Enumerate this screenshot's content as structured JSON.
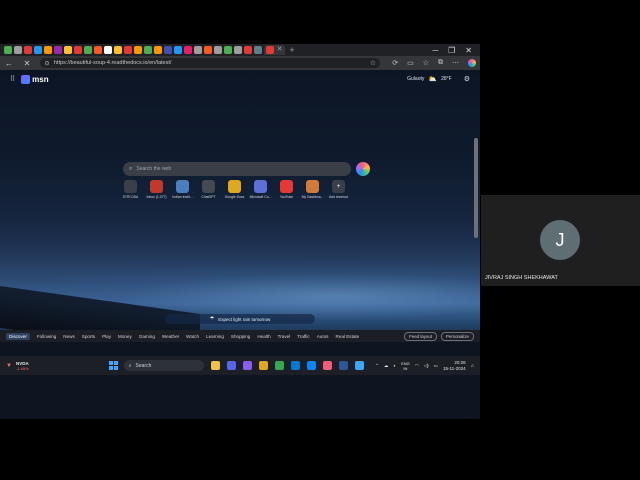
{
  "browser": {
    "url": "https://beautiful-soup-4.readthedocs.io/en/latest/",
    "tab_favicon_colors": [
      "#4caf50",
      "#9e9e9e",
      "#e53935",
      "#2196f3",
      "#ff9800",
      "#9c27b0",
      "#fbc02d",
      "#e53935",
      "#4caf50",
      "#ff5722",
      "#ffffff",
      "#fbc02d",
      "#e53935",
      "#ff9800",
      "#4caf50",
      "#ff9800",
      "#3f51b5",
      "#2196f3",
      "#e91e63",
      "#9e9e9e",
      "#ff5722",
      "#9e9e9e",
      "#4caf50",
      "#9e9e9e",
      "#e53935",
      "#607d8b"
    ]
  },
  "msn": {
    "logo": "msn",
    "location": "Gulaoty",
    "temperature": "28°F",
    "search_placeholder": "Search the web",
    "shortcuts": [
      {
        "label": "STRI DSA",
        "icon": "bookmark-icon",
        "color": "#3b4048"
      },
      {
        "label": "Inbox (1,077)",
        "icon": "mail-icon",
        "color": "#c0392b"
      },
      {
        "label": "Indian Instit...",
        "icon": "site-icon",
        "color": "#4a7fbf"
      },
      {
        "label": "ChatGPT",
        "icon": "chatgpt-icon",
        "color": "#444a52"
      },
      {
        "label": "Google Docs",
        "icon": "chrome-icon",
        "color": "#e0a81f"
      },
      {
        "label": "Microsoft Co...",
        "icon": "copilot-icon",
        "color": "#5e6fd8"
      },
      {
        "label": "YouTube",
        "icon": "youtube-icon",
        "color": "#e53935"
      },
      {
        "label": "My Dashboa...",
        "icon": "dashboard-icon",
        "color": "#d17a3a"
      },
      {
        "label": "Add shortcut",
        "icon": "plus-icon",
        "color": "#3b4048"
      }
    ],
    "caption": "Expect light rain tomorrow",
    "feed_tabs": [
      "Discover",
      "Following",
      "News",
      "Sports",
      "Play",
      "Money",
      "Gaming",
      "Weather",
      "Watch",
      "Learning",
      "Shopping",
      "Health",
      "Travel",
      "Traffic",
      "Autos",
      "Real Estate"
    ],
    "feed_selected": "Discover",
    "feed_layout_label": "Feed layout",
    "personalize_label": "Personalize"
  },
  "taskbar": {
    "stock_name": "NVDA",
    "stock_change": "-1.65%",
    "search_label": "Search",
    "lang_top": "ENG",
    "lang_bottom": "IN",
    "time": "20:26",
    "date": "15-11-2024",
    "app_colors": [
      "#f0c14b",
      "#5865f2",
      "#8b5cf6",
      "#e0a81f",
      "#34a853",
      "#0078d4",
      "#0a84ff",
      "#f35d7a",
      "#2b579a",
      "#3aa8ff"
    ]
  },
  "participant": {
    "initial": "J",
    "name": "JIVRAJ SINGH SHEKHAWAT"
  }
}
